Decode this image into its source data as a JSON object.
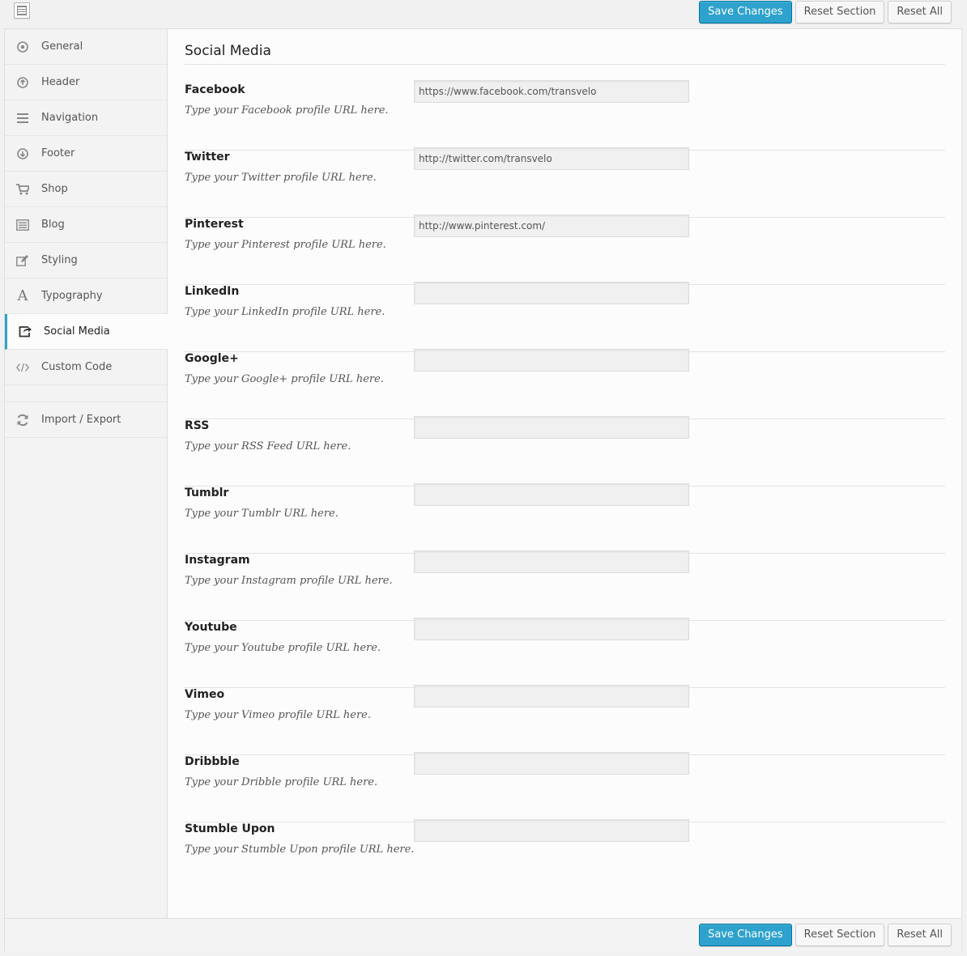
{
  "buttons": {
    "save": "Save Changes",
    "reset_section": "Reset Section",
    "reset_all": "Reset All"
  },
  "sidebar": {
    "items": [
      {
        "label": "General",
        "icon": "circle-dot-icon"
      },
      {
        "label": "Header",
        "icon": "arrow-up-circle-icon"
      },
      {
        "label": "Navigation",
        "icon": "menu-lines-icon"
      },
      {
        "label": "Footer",
        "icon": "arrow-down-circle-icon"
      },
      {
        "label": "Shop",
        "icon": "cart-icon"
      },
      {
        "label": "Blog",
        "icon": "list-icon"
      },
      {
        "label": "Styling",
        "icon": "edit-icon"
      },
      {
        "label": "Typography",
        "icon": "letter-a-icon"
      },
      {
        "label": "Social Media",
        "icon": "share-icon"
      },
      {
        "label": "Custom Code",
        "icon": "code-icon"
      }
    ],
    "import_export": {
      "label": "Import / Export",
      "icon": "refresh-icon"
    },
    "active": "Social Media"
  },
  "section": {
    "title": "Social Media"
  },
  "fields": [
    {
      "label": "Facebook",
      "desc": "Type your Facebook profile URL here.",
      "value": "https://www.facebook.com/transvelo"
    },
    {
      "label": "Twitter",
      "desc": "Type your Twitter profile URL here.",
      "value": "http://twitter.com/transvelo"
    },
    {
      "label": "Pinterest",
      "desc": "Type your Pinterest profile URL here.",
      "value": "http://www.pinterest.com/"
    },
    {
      "label": "LinkedIn",
      "desc": "Type your LinkedIn profile URL here.",
      "value": ""
    },
    {
      "label": "Google+",
      "desc": "Type your Google+ profile URL here.",
      "value": ""
    },
    {
      "label": "RSS",
      "desc": "Type your RSS Feed URL here.",
      "value": ""
    },
    {
      "label": "Tumblr",
      "desc": "Type your Tumblr URL here.",
      "value": ""
    },
    {
      "label": "Instagram",
      "desc": "Type your Instagram profile URL here.",
      "value": ""
    },
    {
      "label": "Youtube",
      "desc": "Type your Youtube profile URL here.",
      "value": ""
    },
    {
      "label": "Vimeo",
      "desc": "Type your Vimeo profile URL here.",
      "value": ""
    },
    {
      "label": "Dribbble",
      "desc": "Type your Dribble profile URL here.",
      "value": ""
    },
    {
      "label": "Stumble Upon",
      "desc": "Type your Stumble Upon profile URL here.",
      "value": ""
    }
  ],
  "colors": {
    "primary": "#2ea2cc",
    "primary_border": "#0074a2",
    "background": "#f1f1f1"
  }
}
